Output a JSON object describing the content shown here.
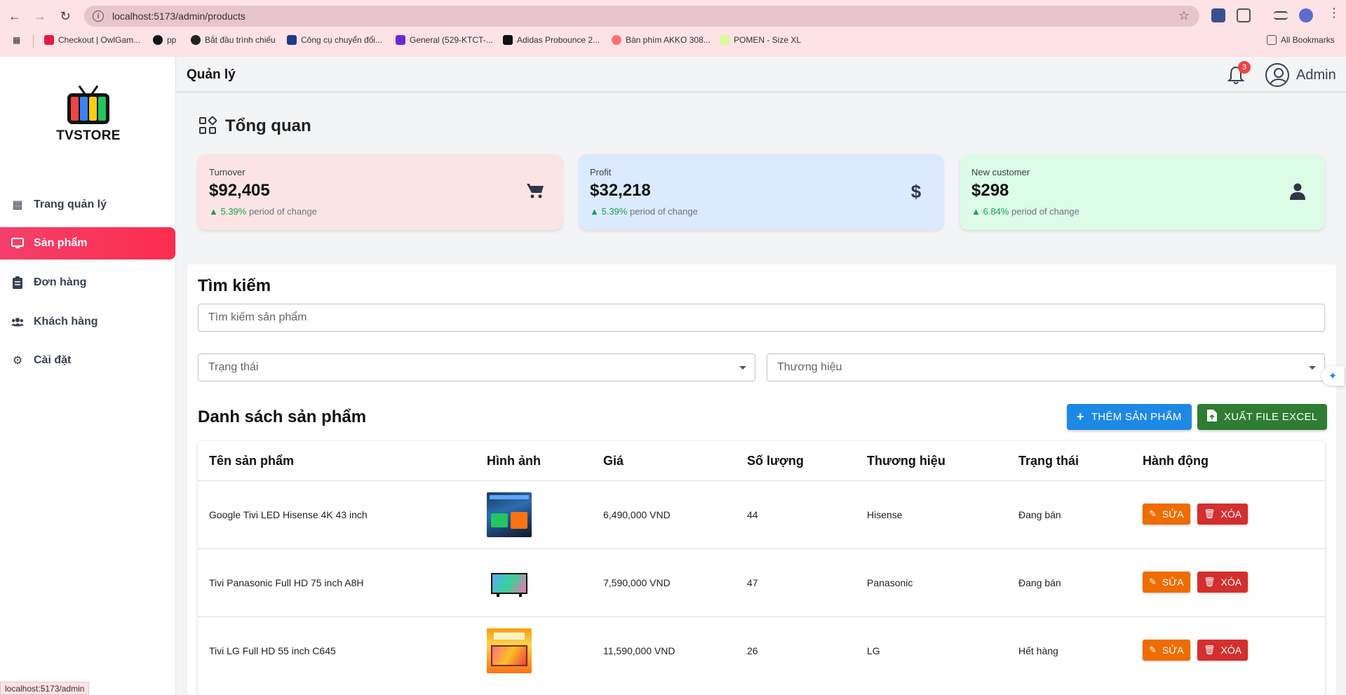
{
  "browser": {
    "url": "localhost:5173/admin/products",
    "bookmarks": [
      {
        "label": "Checkout | OwlGam...",
        "color": "#e11d48"
      },
      {
        "label": "pp",
        "color": "#111111"
      },
      {
        "label": "Bắt đầu trình chiếu",
        "color": "#222222"
      },
      {
        "label": "Công cụ chuyển đổi...",
        "color": "#1e3a8a"
      },
      {
        "label": "General (529-KTCT-...",
        "color": "#6d28d9"
      },
      {
        "label": "Adidas Probounce 2...",
        "color": "#111111"
      },
      {
        "label": "Bàn phím AKKO 308...",
        "color": "#f87171"
      },
      {
        "label": "POMEN - Size XL",
        "color": "#d9f99d"
      }
    ],
    "all_bookmarks": "All Bookmarks",
    "status_url": "localhost:5173/admin"
  },
  "sidebar": {
    "brand": "TVSTORE",
    "items": [
      {
        "label": "Trang quản lý",
        "icon": "dashboard-icon"
      },
      {
        "label": "Sản phẩm",
        "icon": "monitor-icon",
        "active": true
      },
      {
        "label": "Đơn hàng",
        "icon": "clipboard-icon"
      },
      {
        "label": "Khách hàng",
        "icon": "users-icon"
      },
      {
        "label": "Cài đặt",
        "icon": "gear-icon"
      }
    ]
  },
  "header": {
    "title": "Quản lý",
    "notification_count": "3",
    "username": "Admin"
  },
  "overview": {
    "title": "Tổng quan",
    "cards": [
      {
        "label": "Turnover",
        "value": "$92,405",
        "change": "5.39%",
        "change_text": "period of change",
        "bg": "#fde4e4",
        "icon": "cart-icon"
      },
      {
        "label": "Profit",
        "value": "$32,218",
        "change": "5.39%",
        "change_text": "period of change",
        "bg": "#dbeafe",
        "icon": "dollar-icon"
      },
      {
        "label": "New customer",
        "value": "$298",
        "change": "6.84%",
        "change_text": "period of change",
        "bg": "#dcfce7",
        "icon": "user-icon"
      }
    ]
  },
  "search": {
    "title": "Tìm kiếm",
    "placeholder": "Tìm kiếm sản phẩm",
    "status_placeholder": "Trạng thái",
    "brand_placeholder": "Thương hiệu"
  },
  "products": {
    "title": "Danh sách sản phẩm",
    "add_button": "THÊM SẢN PHẨM",
    "export_button": "XUẤT FILE EXCEL",
    "columns": [
      "Tên sản phẩm",
      "Hình ảnh",
      "Giá",
      "Số lượng",
      "Thương hiệu",
      "Trạng thái",
      "Hành động"
    ],
    "edit_label": "SỬA",
    "delete_label": "XÓA",
    "rows": [
      {
        "name": "Google Tivi LED Hisense 4K 43 inch",
        "price": "6,490,000 VND",
        "qty": "44",
        "brand": "Hisense",
        "status": "Đang bán"
      },
      {
        "name": "Tivi Panasonic Full HD 75 inch A8H",
        "price": "7,590,000 VND",
        "qty": "47",
        "brand": "Panasonic",
        "status": "Đang bán"
      },
      {
        "name": "Tivi LG Full HD 55 inch C645",
        "price": "11,590,000 VND",
        "qty": "26",
        "brand": "LG",
        "status": "Hết hàng"
      }
    ]
  },
  "colors": {
    "accent": "#f43f6b",
    "primary_button": "#1e88e5",
    "export_button": "#2e7d32",
    "edit_button": "#ef6c00",
    "delete_button": "#d32f2f"
  }
}
